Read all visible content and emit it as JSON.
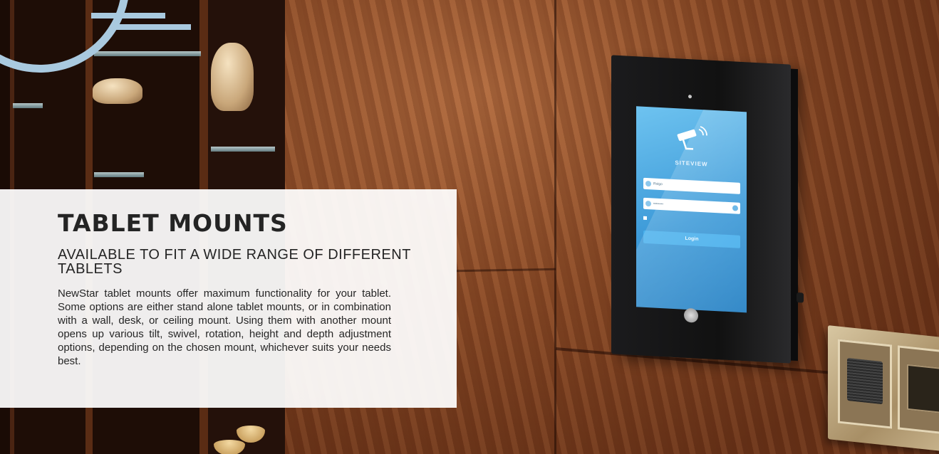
{
  "hero": {
    "title": "TABLET MOUNTS",
    "subtitle": "AVAILABLE TO FIT A WIDE RANGE OF DIFFERENT TABLETS",
    "body": "NewStar tablet mounts offer maximum functionality for your tablet. Some options are either stand alone tablet mounts, or in combination with a wall, desk, or ceiling mount. Using them with another mount opens up various tilt, swivel, rotation, height and depth adjustment options, depending on the chosen mount, whichever suits your needs best."
  },
  "tablet_screen": {
    "app_name": "SITEVIEW",
    "username_value": "Rsigo",
    "password_value": "••••••••",
    "login_label": "Login",
    "icons": [
      "security-camera-icon",
      "user-icon",
      "lock-icon",
      "eye-icon"
    ]
  },
  "colors": {
    "accent": "#a9c9df",
    "card_background": "#ffffff",
    "screen_blue": "#3d9ad8",
    "text_dark": "#242424"
  }
}
